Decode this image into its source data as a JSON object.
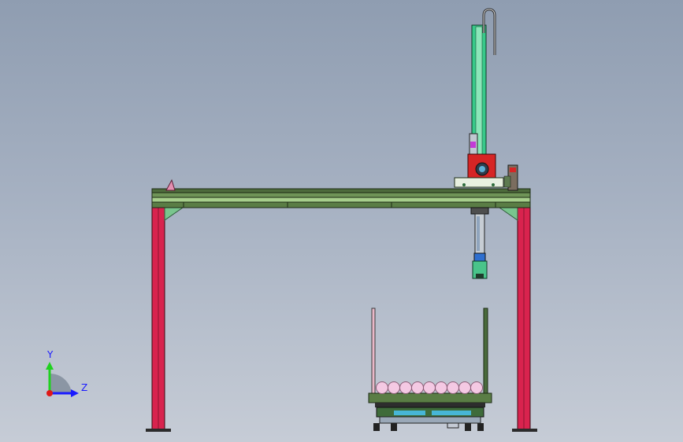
{
  "viewport": {
    "background_top": "#8f9db1",
    "background_bottom": "#c6ccd6"
  },
  "colors": {
    "leg": "#d8234e",
    "beam": "#5a7d45",
    "beam_light": "#a7cf8c",
    "column": "#38c98a",
    "motor": "#d62525",
    "carriage": "#e8f0e0",
    "balls": "#f4c9e3",
    "cart": "#3e6b3a"
  },
  "triad": {
    "y_label": "Y",
    "z_label": "Z",
    "icon": "coordinate-triad-icon"
  }
}
